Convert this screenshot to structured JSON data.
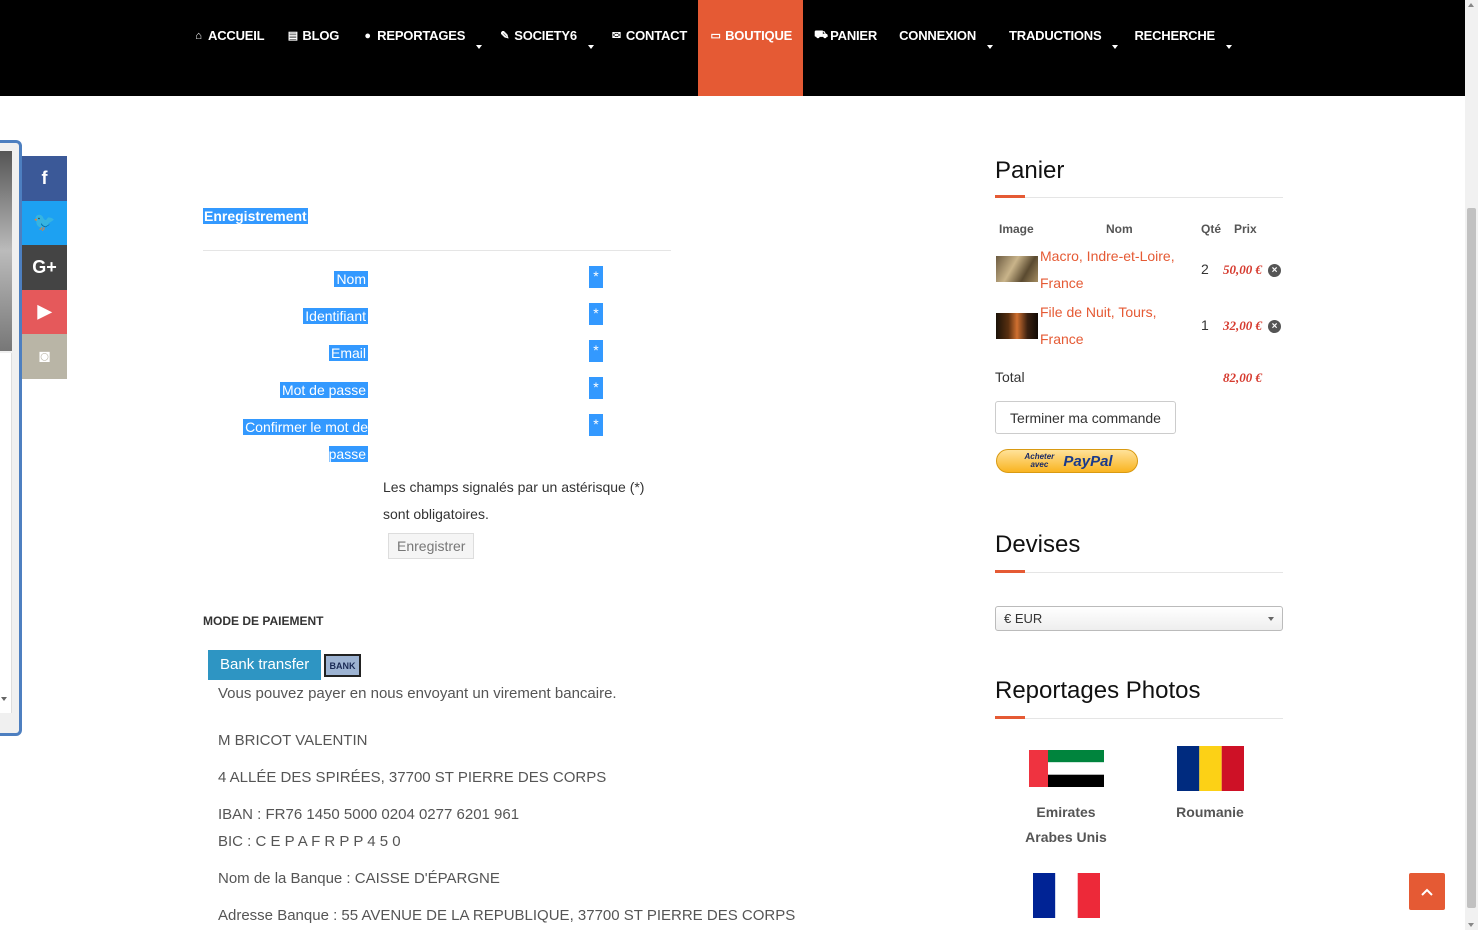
{
  "nav": {
    "items": [
      {
        "icon": "home-icon",
        "glyph": "⌂",
        "label": "ACCUEIL",
        "caret": false,
        "active": false
      },
      {
        "icon": "newspaper-icon",
        "glyph": "▤",
        "label": "BLOG",
        "caret": false,
        "active": false
      },
      {
        "icon": "globe-icon",
        "glyph": "●",
        "label": "REPORTAGES",
        "caret": true,
        "active": false
      },
      {
        "icon": "brush-icon",
        "glyph": "✎",
        "label": "SOCIETY6",
        "caret": true,
        "active": false
      },
      {
        "icon": "envelope-icon",
        "glyph": "✉",
        "label": "CONTACT",
        "caret": false,
        "active": false
      },
      {
        "icon": "credit-card-icon",
        "glyph": "▭",
        "label": "BOUTIQUE",
        "caret": false,
        "active": true
      },
      {
        "icon": "cart-icon",
        "glyph": "⛟",
        "label": "PANIER",
        "caret": false,
        "active": false
      },
      {
        "icon": "",
        "glyph": "",
        "label": "CONNEXION",
        "caret": true,
        "active": false
      },
      {
        "icon": "",
        "glyph": "",
        "label": "TRADUCTIONS",
        "caret": true,
        "active": false
      },
      {
        "icon": "",
        "glyph": "",
        "label": "RECHERCHE",
        "caret": true,
        "active": false
      }
    ],
    "active_color": "#e55a34"
  },
  "social": [
    {
      "name": "facebook",
      "glyph": "f",
      "color": "#3b5998"
    },
    {
      "name": "twitter",
      "glyph": "🐦",
      "color": "#1da1f2"
    },
    {
      "name": "google-plus",
      "glyph": "G+",
      "color": "#444444"
    },
    {
      "name": "youtube",
      "glyph": "▶",
      "color": "#e5595b"
    },
    {
      "name": "instagram",
      "glyph": "◙",
      "color": "#b9b5a6"
    }
  ],
  "registration": {
    "title": "Enregistrement",
    "fields": [
      {
        "label": "Nom",
        "required": "*"
      },
      {
        "label": "Identifiant",
        "required": "*"
      },
      {
        "label": "Email",
        "required": "*"
      },
      {
        "label": "Mot de passe",
        "required": "*"
      },
      {
        "label": "Confirmer le mot de passe",
        "required": "*"
      }
    ],
    "note": "Les champs signalés par un astérisque (*) sont obligatoires.",
    "submit": "Enregistrer"
  },
  "payment": {
    "title": "MODE DE PAIEMENT",
    "method": "Bank transfer",
    "logo_text": "BANK",
    "description": "Vous pouvez payer en nous envoyant un virement bancaire.",
    "holder": "M BRICOT VALENTIN",
    "address": "4 ALLÉE DES SPIRÉES, 37700 ST PIERRE DES CORPS",
    "iban": "IBAN : FR76 1450 5000 0204 0277 6201 961",
    "bic": "BIC : C E P A F R P P 4 5 0",
    "bank_name": "Nom de la Banque : CAISSE D'ÉPARGNE",
    "bank_address": "Adresse Banque : 55 AVENUE DE LA REPUBLIQUE, 37700 ST PIERRE DES CORPS"
  },
  "cart": {
    "title": "Panier",
    "headers": {
      "image": "Image",
      "name": "Nom",
      "qty": "Qté",
      "price": "Prix"
    },
    "items": [
      {
        "name": "Macro, Indre-et-Loire, France",
        "qty": "2",
        "price": "50,00 €"
      },
      {
        "name": "File de Nuit, Tours, France",
        "qty": "1",
        "price": "32,00 €"
      }
    ],
    "total_label": "Total",
    "total": "82,00 €",
    "checkout": "Terminer ma commande",
    "paypal_small": "Acheter avec",
    "paypal_brand": "PayPal"
  },
  "currency": {
    "title": "Devises",
    "selected": "€ EUR"
  },
  "reports": {
    "title": "Reportages Photos",
    "countries": [
      {
        "name": "Emirates Arabes Unis"
      },
      {
        "name": "Roumanie"
      },
      {
        "name": "France"
      }
    ]
  }
}
